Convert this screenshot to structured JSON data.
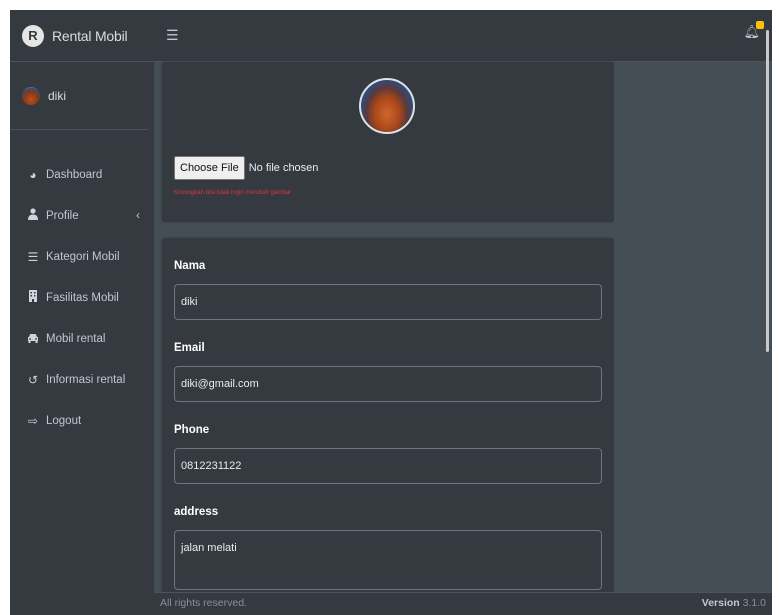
{
  "brand": {
    "logo_letter": "R",
    "title": "Rental Mobil"
  },
  "user": {
    "name": "diki"
  },
  "sidebar": {
    "items": [
      {
        "label": "Dashboard",
        "icon": "tachometer-icon"
      },
      {
        "label": "Profile",
        "icon": "user-icon",
        "caret": "‹"
      },
      {
        "label": "Kategori Mobil",
        "icon": "list-icon"
      },
      {
        "label": "Fasilitas Mobil",
        "icon": "building-icon"
      },
      {
        "label": "Mobil rental",
        "icon": "car-icon"
      },
      {
        "label": "Informasi rental",
        "icon": "history-icon"
      },
      {
        "label": "Logout",
        "icon": "logout-icon"
      }
    ]
  },
  "navbar": {
    "menu_icon": "bars-icon",
    "notify_icon": "bell-icon"
  },
  "photo": {
    "choose_label": "Choose File",
    "file_status": "No file chosen",
    "hint": "Kosongkan bila tidak ingin merubah gambar"
  },
  "form": {
    "fields": [
      {
        "label": "Nama",
        "value": "diki"
      },
      {
        "label": "Email",
        "value": "diki@gmail.com"
      },
      {
        "label": "Phone",
        "value": "0812231122"
      },
      {
        "label": "address",
        "value": "jalan melati"
      }
    ]
  },
  "footer": {
    "text": "All rights reserved.",
    "version_label": "Version",
    "version": "3.1.0"
  },
  "colors": {
    "sidebar": "#343a40",
    "content": "#454d55",
    "badge": "#ffc107",
    "hint": "#dc3545"
  }
}
